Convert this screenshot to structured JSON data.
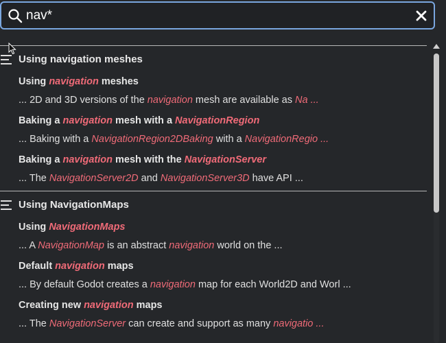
{
  "search": {
    "value": "nav*",
    "placeholder": ""
  },
  "colors": {
    "highlight": "#f06b78",
    "focus_border": "#7aa7e0",
    "background": "#25272a"
  },
  "sections": [
    {
      "title": "Using navigation meshes",
      "icon": "list-icon",
      "items": [
        {
          "title": [
            {
              "t": "Using ",
              "h": false
            },
            {
              "t": "navigation",
              "h": true
            },
            {
              "t": " meshes",
              "h": false
            }
          ],
          "snippet": [
            {
              "t": "... 2D and 3D versions of the ",
              "h": false
            },
            {
              "t": "navigation",
              "h": true
            },
            {
              "t": " mesh are available as ",
              "h": false
            },
            {
              "t": "Na ...",
              "h": true
            }
          ]
        },
        {
          "title": [
            {
              "t": "Baking a ",
              "h": false
            },
            {
              "t": "navigation",
              "h": true
            },
            {
              "t": " mesh with a ",
              "h": false
            },
            {
              "t": "NavigationRegion",
              "h": true
            }
          ],
          "snippet": [
            {
              "t": "... Baking with a ",
              "h": false
            },
            {
              "t": "NavigationRegion2DBaking",
              "h": true
            },
            {
              "t": " with a ",
              "h": false
            },
            {
              "t": "NavigationRegio ...",
              "h": true
            }
          ]
        },
        {
          "title": [
            {
              "t": "Baking a ",
              "h": false
            },
            {
              "t": "navigation",
              "h": true
            },
            {
              "t": " mesh with the ",
              "h": false
            },
            {
              "t": "NavigationServer",
              "h": true
            }
          ],
          "snippet": [
            {
              "t": "... The ",
              "h": false
            },
            {
              "t": "NavigationServer2D",
              "h": true
            },
            {
              "t": " and ",
              "h": false
            },
            {
              "t": "NavigationServer3D",
              "h": true
            },
            {
              "t": " have API ...",
              "h": false
            }
          ]
        }
      ]
    },
    {
      "title": "Using NavigationMaps",
      "icon": "list-icon",
      "items": [
        {
          "title": [
            {
              "t": "Using ",
              "h": false
            },
            {
              "t": "NavigationMaps",
              "h": true
            }
          ],
          "snippet": [
            {
              "t": "... A ",
              "h": false
            },
            {
              "t": "NavigationMap",
              "h": true
            },
            {
              "t": " is an abstract ",
              "h": false
            },
            {
              "t": "navigation",
              "h": true
            },
            {
              "t": " world on the ...",
              "h": false
            }
          ]
        },
        {
          "title": [
            {
              "t": "Default ",
              "h": false
            },
            {
              "t": "navigation",
              "h": true
            },
            {
              "t": " maps",
              "h": false
            }
          ],
          "snippet": [
            {
              "t": "... By default Godot creates a ",
              "h": false
            },
            {
              "t": "navigation",
              "h": true
            },
            {
              "t": " map for each World2D and Worl ...",
              "h": false
            }
          ]
        },
        {
          "title": [
            {
              "t": "Creating new ",
              "h": false
            },
            {
              "t": "navigation",
              "h": true
            },
            {
              "t": " maps",
              "h": false
            }
          ],
          "snippet": [
            {
              "t": "... The ",
              "h": false
            },
            {
              "t": "NavigationServer",
              "h": true
            },
            {
              "t": " can create and support as many ",
              "h": false
            },
            {
              "t": "navigatio ...",
              "h": true
            }
          ]
        }
      ]
    }
  ]
}
